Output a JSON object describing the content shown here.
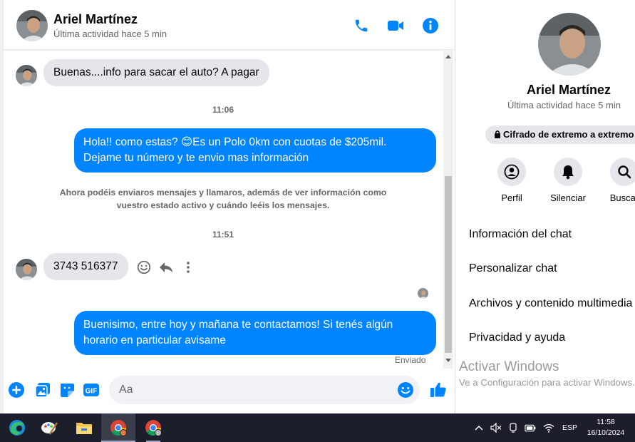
{
  "contact": {
    "name": "Ariel Martínez",
    "status": "Última actividad hace 5 min"
  },
  "header_actions": [
    "phone-icon",
    "video-icon",
    "info-icon"
  ],
  "messages": {
    "m1": "Buenas....info para sacar el auto? A pagar",
    "time1": "11:06",
    "m2_line1": "Hola!! como estas? 😊Es un Polo 0km con cuotas de $205mil.",
    "m2_line2": "Dejame tu número y te envio mas información",
    "system_line1": "Ahora podéis enviaros mensajes y llamaros, además de ver información como",
    "system_line2": "vuestro estado activo y cuándo leéis los mensajes.",
    "time2": "11:51",
    "m3": "3743 516377",
    "m4_line1": "Buenisimo, entre hoy y mañana te contactamos! Si tenés algún",
    "m4_line2": "horario en particular avisame",
    "sent_status": "Enviado"
  },
  "composer": {
    "placeholder": "Aa"
  },
  "panel": {
    "name": "Ariel Martínez",
    "status": "Última actividad hace 5 min",
    "encryption": "Cifrado de extremo a extremo",
    "actions": [
      {
        "label": "Perfil",
        "icon": "profile-icon"
      },
      {
        "label": "Silenciar",
        "icon": "bell-icon"
      },
      {
        "label": "Buscar",
        "icon": "search-icon"
      }
    ],
    "menu": [
      "Información del chat",
      "Personalizar chat",
      "Archivos y contenido multimedia",
      "Privacidad y ayuda"
    ]
  },
  "watermark": {
    "title": "Activar Windows",
    "subtitle": "Ve a Configuración para activar Windows."
  },
  "taskbar": {
    "language": "ESP",
    "time": "11:58",
    "date": "16/10/2024"
  },
  "colors": {
    "accent": "#0084ff",
    "bubble_in": "#e4e6eb",
    "taskbar": "#1c1f2b"
  }
}
